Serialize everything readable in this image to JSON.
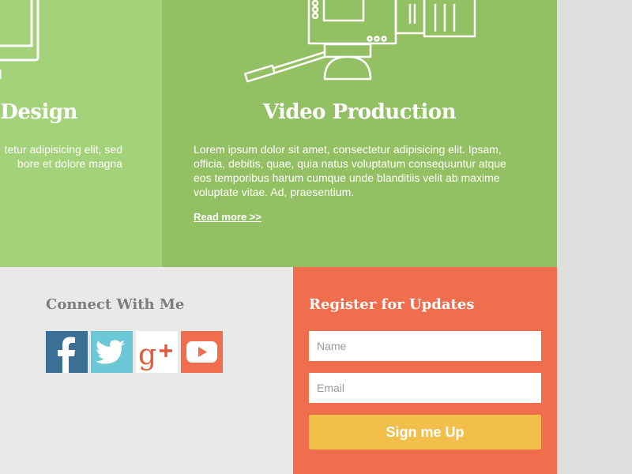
{
  "services": [
    {
      "title": "t Design",
      "description_lines": [
        "tetur adipisicing elit, sed",
        "bore et dolore magna"
      ],
      "icon": "monitor-icon"
    },
    {
      "title": "Video Production",
      "description": "Lorem ipsum dolor sit amet, consectetur adipisicing elit. Ipsam, officia, debitis, quae, quia natus voluptatum consequuntur atque eos temporibus harum cumque unde blanditiis velit ab maxime voluptate vitae. Ad, praesentium.",
      "read_more": "Read more >>",
      "icon": "video-camera-icon"
    }
  ],
  "connect": {
    "heading": "Connect With Me",
    "social": [
      {
        "name": "facebook-icon",
        "color": "#3a6f96"
      },
      {
        "name": "twitter-icon",
        "color": "#6cc7d6"
      },
      {
        "name": "google-plus-icon",
        "color": "#ffffff"
      },
      {
        "name": "youtube-icon",
        "color": "#f06e4d"
      }
    ]
  },
  "register": {
    "title": "Register for Updates",
    "name_placeholder": "Name",
    "email_placeholder": "Email",
    "button_label": "Sign me Up"
  },
  "colors": {
    "green_light": "#a3d27a",
    "green": "#92c062",
    "orange": "#f06e4d",
    "yellow": "#f2bf4b",
    "page_bg": "#e9e9e9"
  }
}
